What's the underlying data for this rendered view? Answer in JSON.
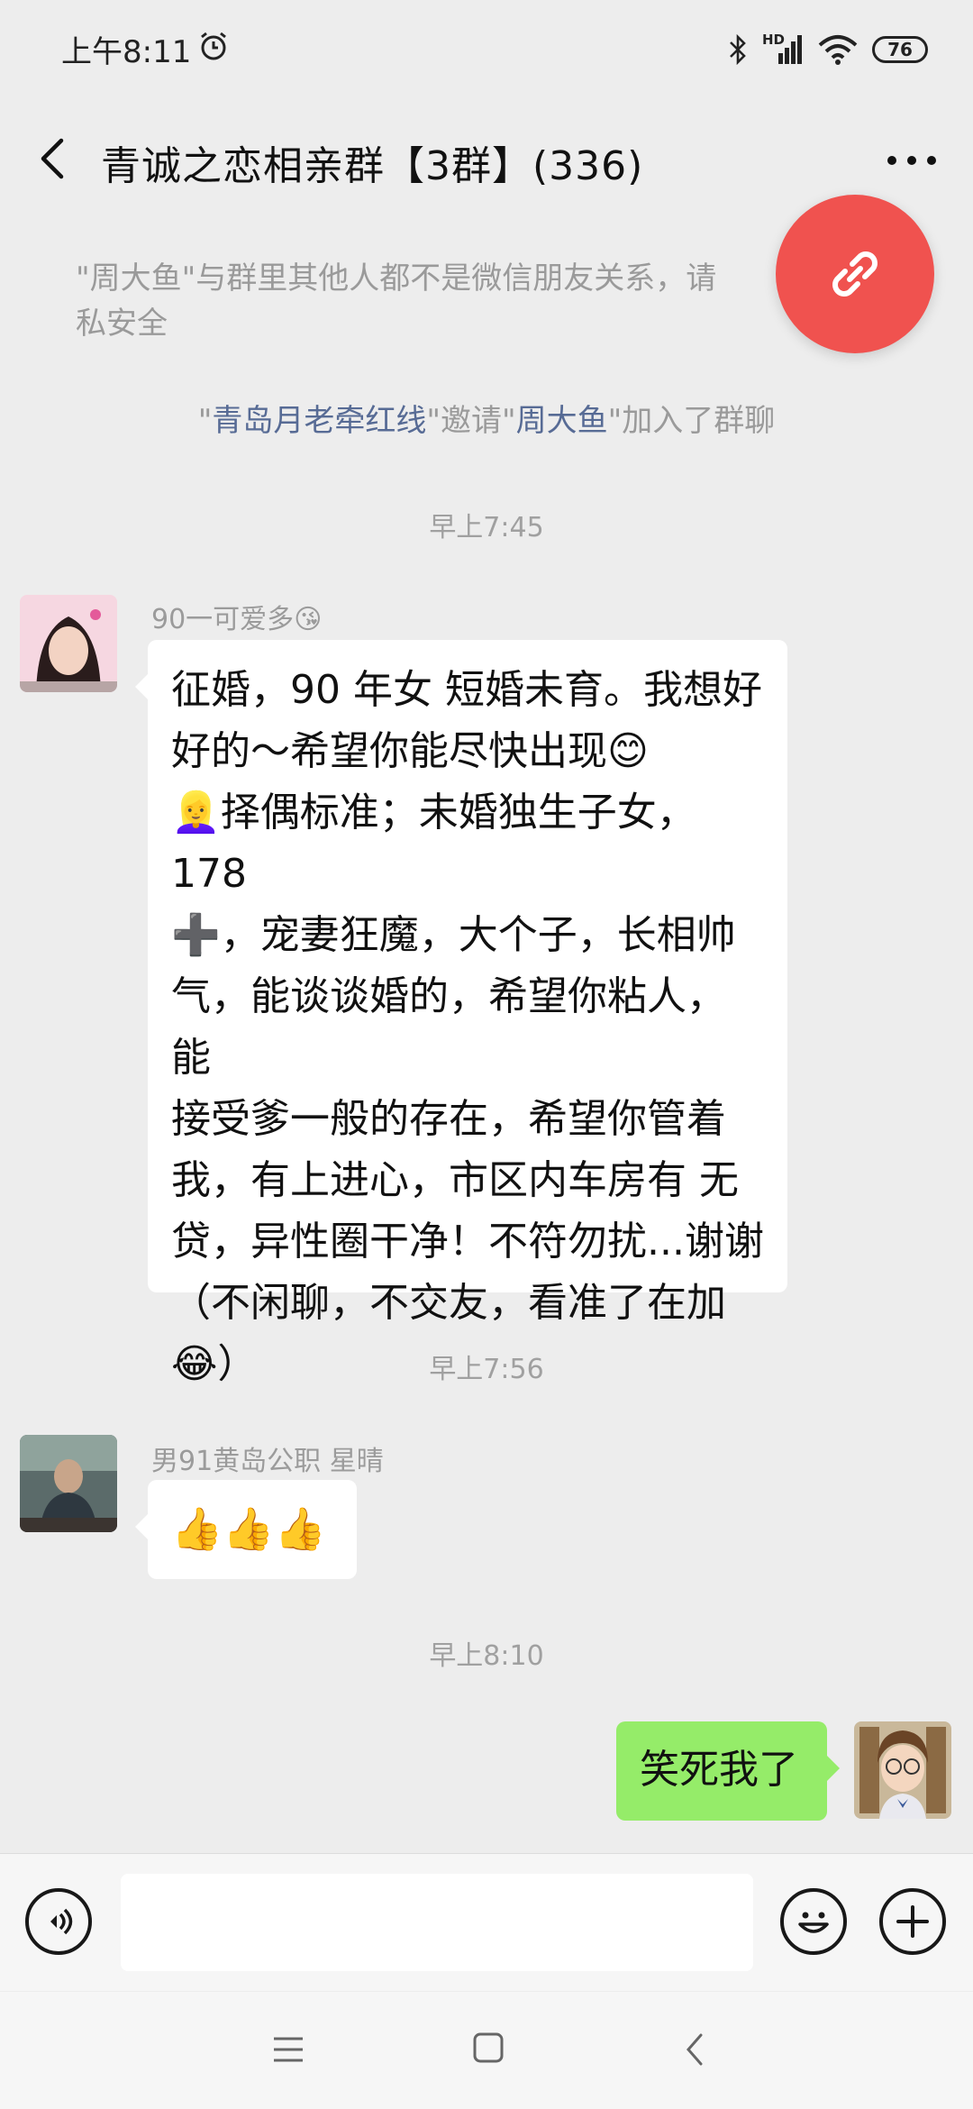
{
  "status_bar": {
    "time": "上午8:11",
    "network": "HD",
    "battery": "76"
  },
  "header": {
    "title": "青诚之恋相亲群【3群】(336)"
  },
  "system_messages": {
    "privacy_notice_line1": "\"周大鱼\"与群里其他人都不是微信朋友关系，请",
    "privacy_notice_line2": "私安全",
    "invite": {
      "q1": "\"",
      "inviter": "青岛月老牵红线",
      "mid": "\"邀请\"",
      "invitee": "周大鱼",
      "end": "\"加入了群聊"
    }
  },
  "messages": [
    {
      "time": "早上7:45"
    },
    {
      "sender": "90一可爱多😘",
      "lines": [
        "征婚，90 年女 短婚未育。我想好",
        "好的～希望你能尽快出现😊",
        "👱‍♀️择偶标准；未婚独生子女，178",
        "➕，宠妻狂魔，大个子，长相帅",
        "气，能谈谈婚的，希望你粘人，能",
        "接受爹一般的存在，希望你管着",
        "我，有上进心，市区内车房有 无",
        "贷，异性圈干净！不符勿扰...谢谢",
        "（不闲聊，不交友，看准了在加",
        "😂）"
      ]
    },
    {
      "time": "早上7:56"
    },
    {
      "sender": "男91黄岛公职 星晴",
      "text": "👍👍👍"
    },
    {
      "time": "早上8:10"
    },
    {
      "sender": "me",
      "text": "笑死我了"
    }
  ],
  "input": {
    "placeholder": ""
  },
  "colors": {
    "background": "#ededed",
    "bubble_other": "#ffffff",
    "bubble_self": "#95ec69",
    "link": "#576b95",
    "fab": "#f0524f"
  },
  "icons": [
    "alarm-icon",
    "bluetooth-icon",
    "signal-icon",
    "wifi-icon",
    "battery-icon",
    "back-icon",
    "more-icon",
    "link-icon",
    "voice-icon",
    "emoji-icon",
    "plus-icon",
    "menu-nav-icon",
    "home-nav-icon",
    "back-nav-icon"
  ]
}
